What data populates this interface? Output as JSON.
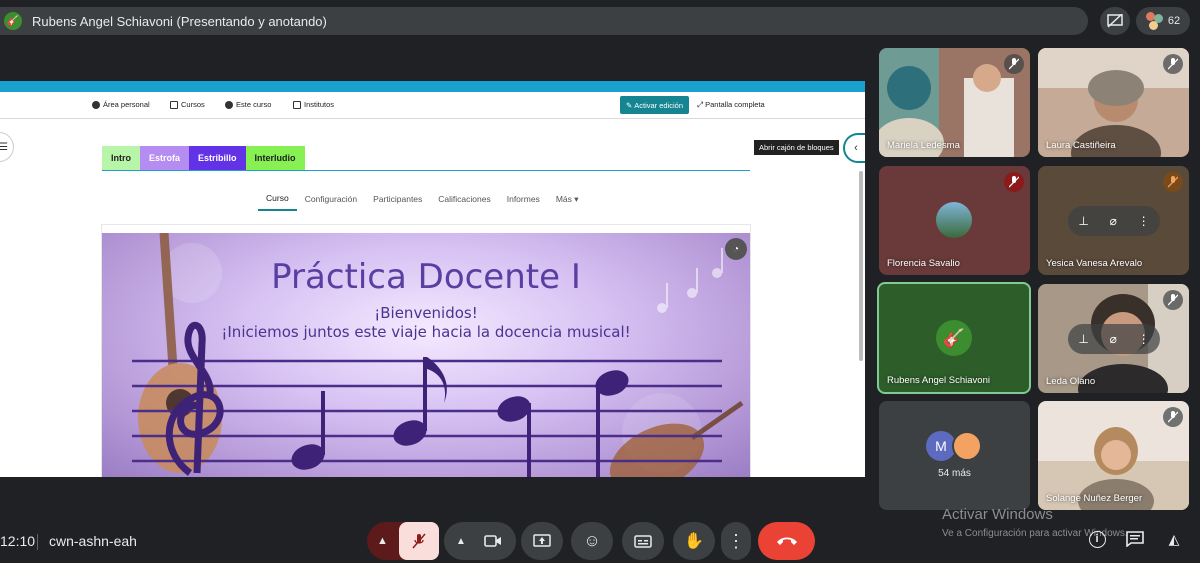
{
  "topbar": {
    "presenter_label": "Rubens Angel Schiavoni (Presentando y anotando)",
    "participant_count": "62"
  },
  "moodle": {
    "nav": {
      "area_personal": "Área personal",
      "cursos": "Cursos",
      "este_curso": "Este curso",
      "institutos": "Institutos",
      "edit_button": "Activar edición",
      "fullscreen": "Pantalla completa"
    },
    "drawer_tooltip": "Abrir cajón de bloques",
    "tabs": [
      {
        "label": "Intro",
        "color": "#b7f5a8",
        "text": "#222222"
      },
      {
        "label": "Estrofa",
        "color": "#b58df2",
        "text": "#ffffff"
      },
      {
        "label": "Estribillo",
        "color": "#6233e6",
        "text": "#ffffff"
      },
      {
        "label": "Interludio",
        "color": "#87f052",
        "text": "#222222"
      }
    ],
    "course_menu": [
      "Curso",
      "Configuración",
      "Participantes",
      "Calificaciones",
      "Informes",
      "Más"
    ],
    "banner": {
      "title": "Práctica Docente I",
      "line1": "¡Bienvenidos!",
      "line2": "¡Iniciemos juntos este viaje hacia la docencia musical!"
    }
  },
  "participants": [
    {
      "name": "Mariela Ledesma",
      "bg": "#8a6a5a"
    },
    {
      "name": "Laura Castiñeira",
      "bg": "#b79b86"
    },
    {
      "name": "Florencia Savalio",
      "bg": "#6a3a3a"
    },
    {
      "name": "Yesica Vanesa Arevalo",
      "bg": "#5a4a3a"
    },
    {
      "name": "Rubens Angel Schiavoni",
      "bg": "#2d5e2a"
    },
    {
      "name": "Leda Olano",
      "bg": "#7c6f64"
    },
    {
      "more_initial": "M",
      "more_label": "54 más",
      "bg": "#3c4043"
    },
    {
      "name": "Solange Nuñez Berger",
      "bg": "#c9b8a8"
    }
  ],
  "bottombar": {
    "time": "12:10",
    "meeting_code": "cwn-ashn-eah"
  },
  "watermark": {
    "line1": "Activar Windows",
    "line2": "Ve a Configuración para activar Windows."
  },
  "colors": {
    "meet_bg": "#202124",
    "control_bg": "#3c4043",
    "hangup_red": "#ea4335",
    "mic_off_pink": "#f9dedc",
    "moodle_teal": "#158591",
    "moodle_blue": "#1ba1cf",
    "active_speaker": "#81c995"
  }
}
